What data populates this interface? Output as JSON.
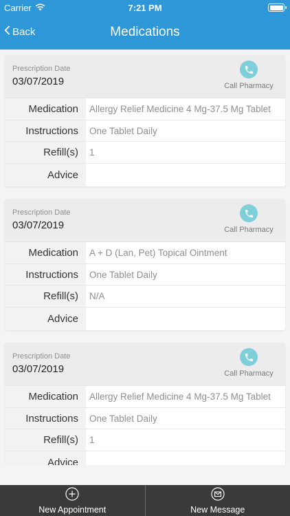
{
  "status_bar": {
    "carrier": "Carrier",
    "time": "7:21 PM"
  },
  "nav": {
    "back_label": "Back",
    "title": "Medications"
  },
  "colors": {
    "header": "#2d97d8",
    "phone_circle": "#7fcfdb",
    "bottom_bar": "#3a3a3a"
  },
  "labels": {
    "prescription_date": "Prescription Date",
    "call_pharmacy": "Call Pharmacy",
    "medication": "Medication",
    "instructions": "Instructions",
    "refills": "Refill(s)",
    "advice": "Advice"
  },
  "prescriptions": [
    {
      "date": "03/07/2019",
      "medication": "Allergy Relief Medicine 4 Mg-37.5 Mg Tablet",
      "instructions": "One Tablet Daily",
      "refills": "1",
      "advice": ""
    },
    {
      "date": "03/07/2019",
      "medication": "A + D (Lan, Pet) Topical Ointment",
      "instructions": "One Tablet Daily",
      "refills": "N/A",
      "advice": ""
    },
    {
      "date": "03/07/2019",
      "medication": "Allergy Relief Medicine 4 Mg-37.5 Mg Tablet",
      "instructions": "One Tablet Daily",
      "refills": "1",
      "advice": ""
    }
  ],
  "bottom_bar": {
    "new_appointment": "New Appointment",
    "new_message": "New Message"
  },
  "icons": [
    "wifi-icon",
    "battery-icon",
    "chevron-left-icon",
    "phone-icon",
    "plus-circle-icon",
    "envelope-circle-icon"
  ]
}
